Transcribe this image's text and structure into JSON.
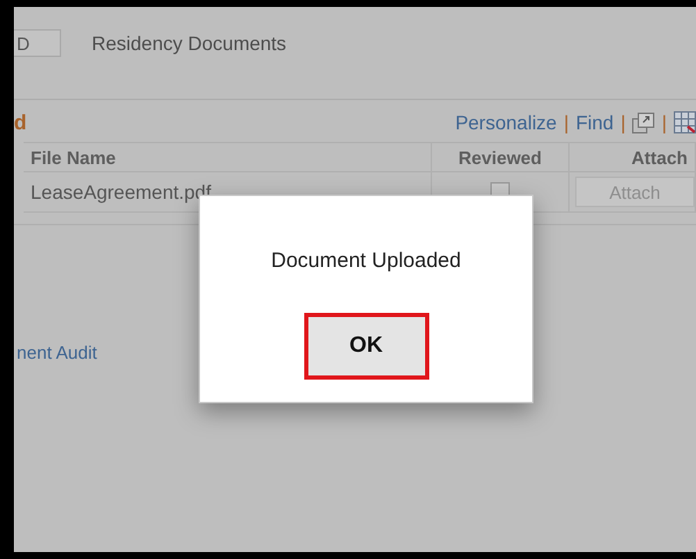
{
  "page": {
    "field": {
      "value": "D"
    },
    "title": "Residency Documents"
  },
  "grid": {
    "title": "d",
    "toolbar": [
      {
        "kind": "link",
        "label": "Personalize"
      },
      {
        "kind": "separator",
        "label": "|"
      },
      {
        "kind": "link",
        "label": "Find"
      },
      {
        "kind": "separator",
        "label": "|"
      },
      {
        "kind": "new-window-icon"
      },
      {
        "kind": "separator",
        "label": "|"
      },
      {
        "kind": "spreadsheet-icon"
      }
    ],
    "columns": [
      "File Name",
      "Reviewed",
      "Attach"
    ],
    "rows": [
      {
        "file_name": "LeaseAgreement.pdf",
        "reviewed": false,
        "attach": {
          "label": "Attach",
          "disabled": true
        }
      }
    ]
  },
  "link": "nent Audit",
  "dialog": {
    "message": "Document Uploaded",
    "button": {
      "label": "OK",
      "focused": true
    }
  }
}
